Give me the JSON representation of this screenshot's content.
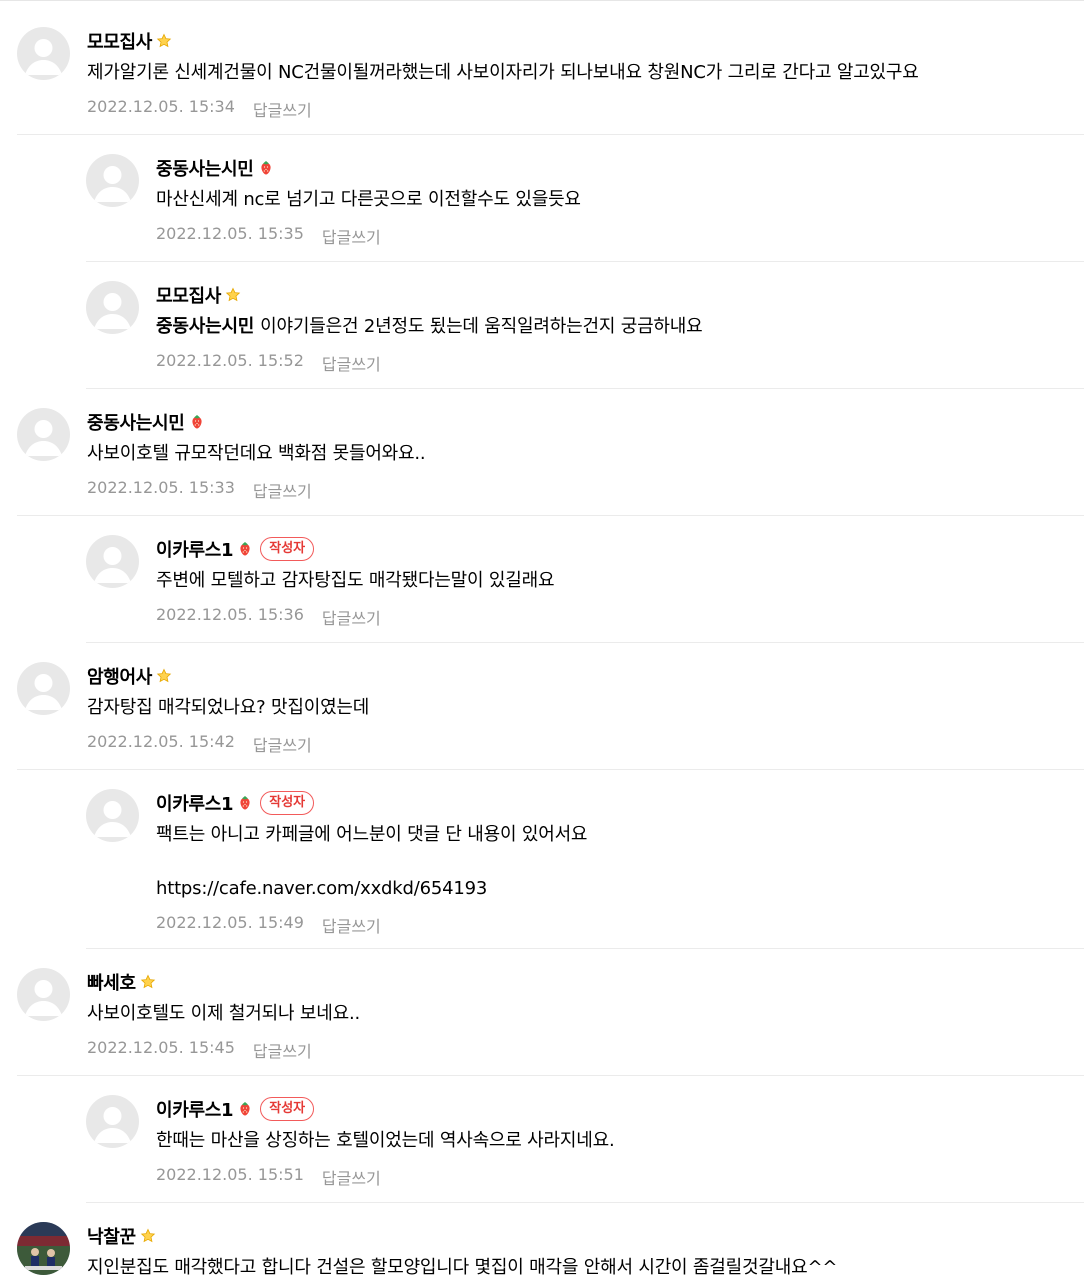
{
  "comments": [
    {
      "nick": "모모집사",
      "grade": "star",
      "text": "제가알기론 신세계건물이 NC건물이될꺼라했는데 사보이자리가 되나보내요 창원NC가 그리로 간다고 알고있구요",
      "date": "2022.12.05. 15:34",
      "reply_label": "답글쓰기"
    },
    {
      "nick": "중동사는시민",
      "grade": "berry",
      "text": "마산신세계 nc로 넘기고 다른곳으로 이전할수도 있을듯요",
      "date": "2022.12.05. 15:35",
      "reply_label": "답글쓰기"
    },
    {
      "nick": "모모집사",
      "grade": "star",
      "mention": "중동사는시민",
      "text": "이야기들은건 2년정도 됬는데 움직일려하는건지 궁금하내요",
      "date": "2022.12.05. 15:52",
      "reply_label": "답글쓰기"
    },
    {
      "nick": "중동사는시민",
      "grade": "berry",
      "text": "사보이호텔 규모작던데요 백화점 못들어와요..",
      "date": "2022.12.05. 15:33",
      "reply_label": "답글쓰기"
    },
    {
      "nick": "이카루스1",
      "grade": "berry",
      "badge": "작성자",
      "text": "주변에 모텔하고 감자탕집도 매각됐다는말이 있길래요",
      "date": "2022.12.05. 15:36",
      "reply_label": "답글쓰기"
    },
    {
      "nick": "암행어사",
      "grade": "star",
      "text": "감자탕집 매각되었나요? 맛집이였는데",
      "date": "2022.12.05. 15:42",
      "reply_label": "답글쓰기"
    },
    {
      "nick": "이카루스1",
      "grade": "berry",
      "badge": "작성자",
      "text": "팩트는 아니고 카페글에 어느분이 댓글 단 내용이 있어서요",
      "link": "https://cafe.naver.com/xxdkd/654193",
      "date": "2022.12.05. 15:49",
      "reply_label": "답글쓰기"
    },
    {
      "nick": "빠세호",
      "grade": "star",
      "text": "사보이호텔도 이제 철거되나 보네요..",
      "date": "2022.12.05. 15:45",
      "reply_label": "답글쓰기"
    },
    {
      "nick": "이카루스1",
      "grade": "berry",
      "badge": "작성자",
      "text": "한때는 마산을 상징하는 호텔이었는데 역사속으로 사라지네요.",
      "date": "2022.12.05. 15:51",
      "reply_label": "답글쓰기"
    },
    {
      "nick": "낙찰꾼",
      "grade": "star",
      "text": "지인분집도 매각했다고 합니다 건설은 할모양입니다 몇집이 매각을 안해서 시간이 좀걸릴것갈내요^^",
      "avatar": "photo"
    }
  ],
  "colors": {
    "meta": "#979797",
    "badge": "#e53935",
    "separator": "#ebebeb"
  }
}
